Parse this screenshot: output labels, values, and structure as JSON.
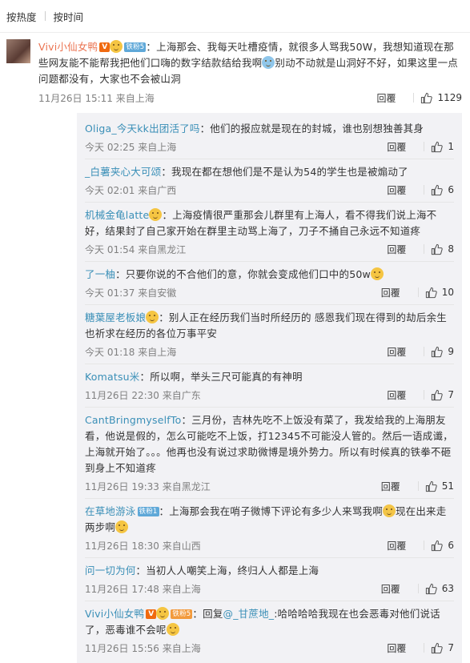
{
  "sort": {
    "hot": "按热度",
    "time": "按时间"
  },
  "main": {
    "user": "Vivi小仙女鸭",
    "vip": "V",
    "fans_level": "铁粉5",
    "text_a": "：上海那会、我每天吐槽疫情，就很多人骂我50W，我想知道现在那些网友能不能帮我把他们口嗨的数字结款结给我啊",
    "text_b": "别动不动就是山洞好不好，如果这里一点问题都没有，大家也不会被山洞",
    "time": "11月26日 15:11 来自上海",
    "reply": "回覆",
    "likes": "1129"
  },
  "replies": [
    {
      "user": "Oliga_今天kk出团活了吗",
      "text": "：他们的报应就是现在的封城，谁也别想独善其身",
      "time": "今天 02:25 来自上海",
      "reply": "回覆",
      "likes": "1"
    },
    {
      "user": "_白薯夹心大可颂",
      "text": "：我现在都在想他们是不是认为54的学生也是被煽动了",
      "time": "今天 02:01 来自广西",
      "reply": "回覆",
      "likes": "6"
    },
    {
      "user": "机械金龟latte",
      "text": "：上海疫情很严重那会儿群里有上海人，看不得我们说上海不好，结果封了自己家开始在群里主动骂上海了，刀子不捅自己永远不知道疼",
      "time": "今天 01:54 来自黑龙江",
      "reply": "回覆",
      "likes": "8",
      "emoji_after_name": true
    },
    {
      "user": "了一柚",
      "text": "：只要你说的不合他们的意，你就会变成他们口中的50w",
      "time": "今天 01:37 来自安徽",
      "reply": "回覆",
      "likes": "10",
      "emoji_end": true
    },
    {
      "user": "糖葉屋老板娘",
      "text": "：别人正在经历我们当时所经历的 感恩我们现在得到的劫后余生 也祈求在经历的各位万事平安",
      "time": "今天 01:18 来自上海",
      "reply": "回覆",
      "likes": "9",
      "emoji_after_name": true
    },
    {
      "user": "Komatsu米",
      "text": "：所以啊，举头三尺可能真的有神明",
      "time": "11月26日 22:30 来自广东",
      "reply": "回覆",
      "likes": "7"
    },
    {
      "user": "CantBringmyselfTo",
      "text": "：三月份，吉林先吃不上饭没有菜了，我发给我的上海朋友看，他说是假的，怎么可能吃不上饭，打12345不可能没人管的。然后一语成谶，上海就开始了。。。他再也没有说过求助微博是境外势力。所以有时候真的铁拳不砸到身上不知道疼",
      "time": "11月26日 19:33 来自黑龙江",
      "reply": "回覆",
      "likes": "51"
    },
    {
      "user": "在草地游泳",
      "fans": "铁粉1",
      "text_a": "：上海那会我在哨子微博下评论有多少人来骂我啊",
      "text_b": "现在出来走两步啊",
      "time": "11月26日 18:30 来自山西",
      "reply": "回覆",
      "likes": "6"
    },
    {
      "user": "问一切为何",
      "text": "：当初人人嘲笑上海，终归人人都是上海",
      "time": "11月26日 17:48 来自上海",
      "reply": "回覆",
      "likes": "63"
    },
    {
      "user": "Vivi小仙女鸭",
      "vip": "V",
      "fans": "铁粉5",
      "text_a": "：回复",
      "mention": "@_甘蔗地_",
      "text_b": ":哈哈哈哈我现在也会恶毒对他们说话了，恶毒谁不会呢",
      "time": "11月26日 15:56 来自上海",
      "reply": "回覆",
      "likes": "7"
    }
  ],
  "colors": {
    "user_main": "#eb7350",
    "user_reply": "#3a8fb7",
    "thread_bg": "#f2f2f5"
  }
}
